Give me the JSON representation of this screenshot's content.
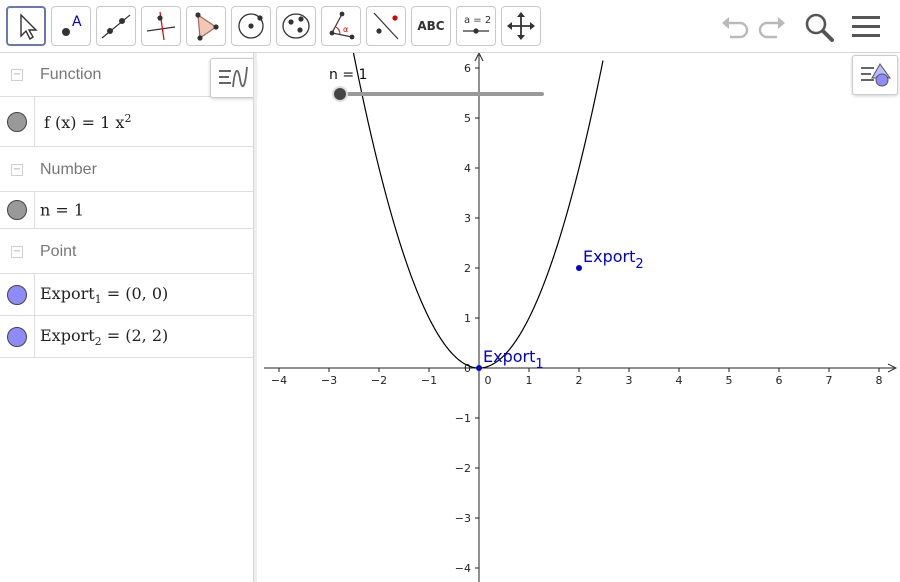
{
  "toolbar": {
    "tools": [
      {
        "name": "move-tool",
        "icon": "arrow-cursor-icon",
        "selected": true
      },
      {
        "name": "point-tool",
        "icon": "point-icon"
      },
      {
        "name": "line-tool",
        "icon": "line-through-two-points-icon"
      },
      {
        "name": "perpendicular-line-tool",
        "icon": "perpendicular-line-icon"
      },
      {
        "name": "polygon-tool",
        "icon": "polygon-icon"
      },
      {
        "name": "circle-center-point-tool",
        "icon": "circle-with-center-icon"
      },
      {
        "name": "ellipse-tool",
        "icon": "ellipse-icon"
      },
      {
        "name": "angle-tool",
        "icon": "angle-icon"
      },
      {
        "name": "reflect-tool",
        "icon": "reflect-about-line-icon"
      },
      {
        "name": "text-tool",
        "icon": "text-icon",
        "label": "ABC"
      },
      {
        "name": "slider-tool",
        "icon": "slider-icon",
        "label": "a = 2"
      },
      {
        "name": "move-graphics-view-tool",
        "icon": "move-view-icon"
      }
    ],
    "right": [
      "undo-icon",
      "redo-icon",
      "search-icon",
      "menu-icon"
    ]
  },
  "algebra": {
    "groups": [
      {
        "header": "Function",
        "items": [
          {
            "name": "f",
            "fn": "f",
            "var": "(x)",
            "eq": "=",
            "coef": "1",
            "base": "x",
            "exp": "2"
          }
        ]
      },
      {
        "header": "Number",
        "items": [
          {
            "name": "n",
            "text": "n = 1"
          }
        ]
      },
      {
        "header": "Point",
        "items": [
          {
            "name": "export1",
            "base": "Export",
            "sub": "1",
            "value": "= (0, 0)"
          },
          {
            "name": "export2",
            "base": "Export",
            "sub": "2",
            "value": "= (2, 2)"
          }
        ]
      }
    ]
  },
  "graphics": {
    "slider": {
      "label": "n = 1",
      "value": 1
    },
    "points": [
      {
        "base": "Export",
        "sub": "1",
        "x": 0,
        "y": 0
      },
      {
        "base": "Export",
        "sub": "2",
        "x": 2,
        "y": 2
      }
    ],
    "x_ticks": [
      "−4",
      "−3",
      "−2",
      "−1",
      "0",
      "1",
      "2",
      "3",
      "4",
      "5",
      "6",
      "7",
      "8"
    ],
    "y_ticks": [
      "6",
      "5",
      "4",
      "3",
      "2",
      "1",
      "0",
      "−1",
      "−2",
      "−3",
      "−4"
    ],
    "colors": {
      "point": "#0000cc",
      "marble_number": "#999999",
      "marble_point": "#8c8cff",
      "curve": "#000000",
      "selected_tool": "#6a77b0"
    }
  }
}
